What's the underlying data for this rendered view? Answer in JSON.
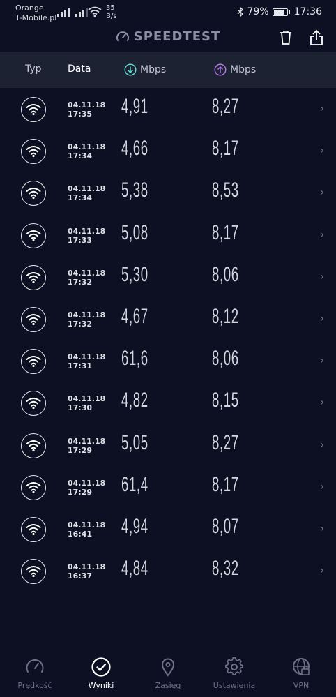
{
  "status": {
    "carrier1": "Orange",
    "carrier2": "T-Mobile.pl",
    "net_speed_value": "35",
    "net_speed_unit": "B/s",
    "battery": "79%",
    "time": "17:36"
  },
  "header": {
    "title": "SPEEDTEST"
  },
  "table": {
    "col_type": "Typ",
    "col_date": "Data",
    "col_download": "Mbps",
    "col_upload": "Mbps"
  },
  "results": [
    {
      "date": "04.11.18",
      "time": "17:35",
      "download": "4,91",
      "upload": "8,27"
    },
    {
      "date": "04.11.18",
      "time": "17:34",
      "download": "4,66",
      "upload": "8,17"
    },
    {
      "date": "04.11.18",
      "time": "17:34",
      "download": "5,38",
      "upload": "8,53"
    },
    {
      "date": "04.11.18",
      "time": "17:33",
      "download": "5,08",
      "upload": "8,17"
    },
    {
      "date": "04.11.18",
      "time": "17:32",
      "download": "5,30",
      "upload": "8,06"
    },
    {
      "date": "04.11.18",
      "time": "17:32",
      "download": "4,67",
      "upload": "8,12"
    },
    {
      "date": "04.11.18",
      "time": "17:31",
      "download": "61,6",
      "upload": "8,06"
    },
    {
      "date": "04.11.18",
      "time": "17:30",
      "download": "4,82",
      "upload": "8,15"
    },
    {
      "date": "04.11.18",
      "time": "17:29",
      "download": "5,05",
      "upload": "8,27"
    },
    {
      "date": "04.11.18",
      "time": "17:29",
      "download": "61,4",
      "upload": "8,17"
    },
    {
      "date": "04.11.18",
      "time": "16:41",
      "download": "4,94",
      "upload": "8,07"
    },
    {
      "date": "04.11.18",
      "time": "16:37",
      "download": "4,84",
      "upload": "8,32"
    }
  ],
  "nav": {
    "speed": "Prędkość",
    "results": "Wyniki",
    "coverage": "Zasięg",
    "settings": "Ustawienia",
    "vpn": "VPN"
  },
  "colors": {
    "background": "#0d1022",
    "header_bar": "#1d2233",
    "download_accent": "#5fe0d8",
    "upload_accent": "#b77bf0"
  }
}
